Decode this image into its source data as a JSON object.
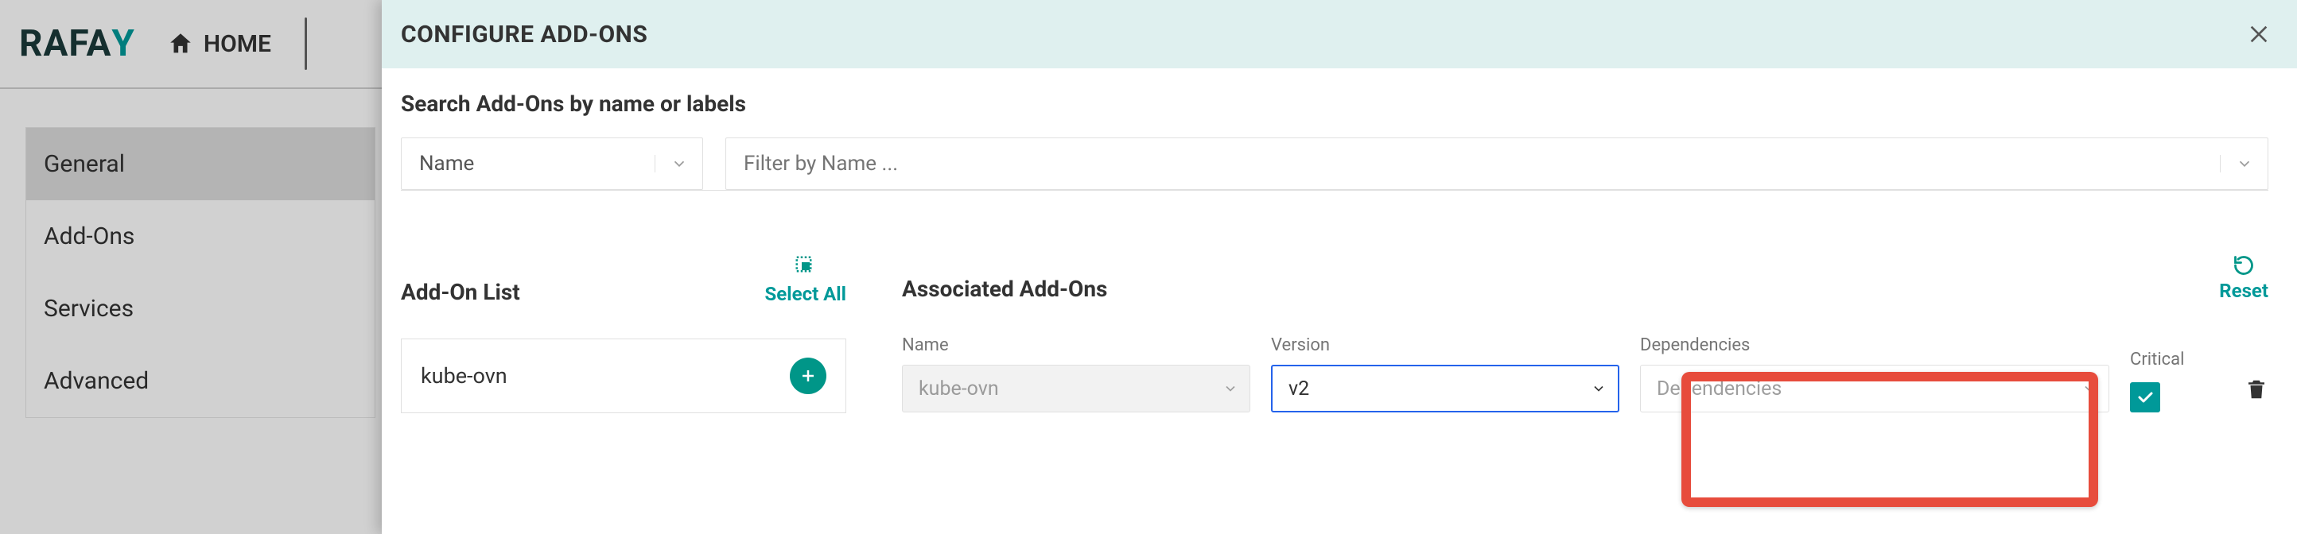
{
  "brand": {
    "text": "RAFAY"
  },
  "nav": {
    "home": "HOME"
  },
  "sidebar": {
    "items": [
      "General",
      "Add-Ons",
      "Services",
      "Advanced"
    ],
    "active_index": 0
  },
  "modal": {
    "title": "CONFIGURE ADD-ONS",
    "search_label": "Search Add-Ons by name or labels",
    "search_by_value": "Name",
    "filter_placeholder": "Filter by Name ...",
    "addon_list_title": "Add-On List",
    "select_all_label": "Select All",
    "associated_title": "Associated Add-Ons",
    "reset_label": "Reset",
    "addon_items": [
      "kube-ovn"
    ],
    "columns": {
      "name": "Name",
      "version": "Version",
      "dependencies": "Dependencies",
      "critical": "Critical"
    },
    "rows": [
      {
        "name": "kube-ovn",
        "version": "v2",
        "dependencies_placeholder": "Dependencies",
        "critical": true
      }
    ]
  },
  "colors": {
    "teal": "#009688",
    "highlight": "#e74c3c",
    "focus": "#2563eb"
  }
}
